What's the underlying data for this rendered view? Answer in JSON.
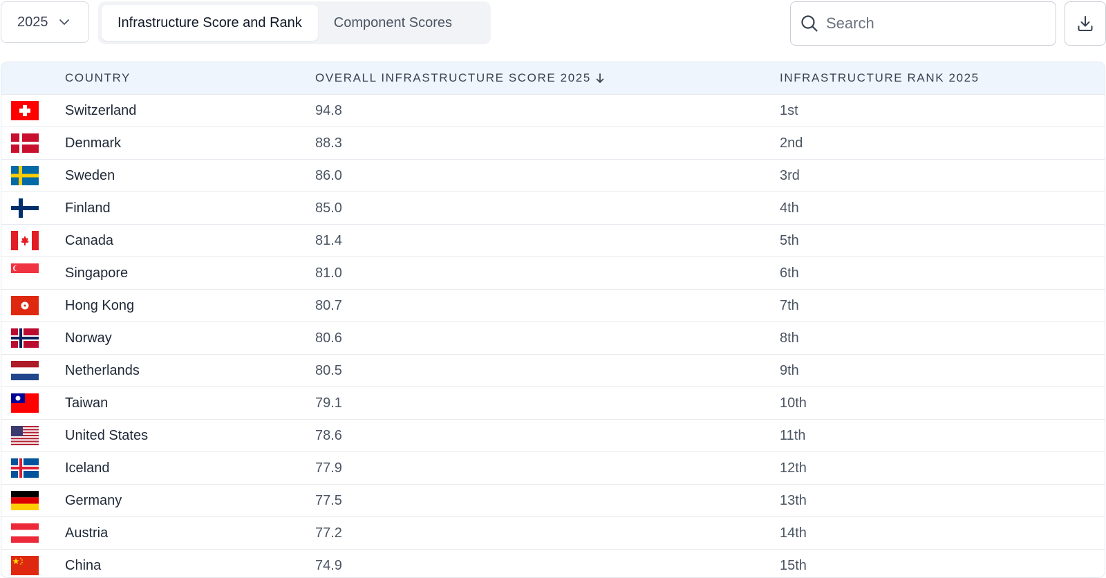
{
  "toolbar": {
    "year": "2025",
    "tabs": [
      {
        "label": "Infrastructure Score and Rank",
        "active": true
      },
      {
        "label": "Component Scores",
        "active": false
      }
    ],
    "search_placeholder": "Search",
    "icons": [
      "chevron-down-icon",
      "search-icon",
      "download-icon"
    ]
  },
  "table": {
    "headers": {
      "country": "COUNTRY",
      "score": "OVERALL INFRASTRUCTURE SCORE 2025",
      "rank": "INFRASTRUCTURE RANK 2025"
    },
    "sort": {
      "column": "score",
      "direction": "descending"
    },
    "rows": [
      {
        "flag": "switzerland",
        "country": "Switzerland",
        "score": "94.8",
        "rank": "1st"
      },
      {
        "flag": "denmark",
        "country": "Denmark",
        "score": "88.3",
        "rank": "2nd"
      },
      {
        "flag": "sweden",
        "country": "Sweden",
        "score": "86.0",
        "rank": "3rd"
      },
      {
        "flag": "finland",
        "country": "Finland",
        "score": "85.0",
        "rank": "4th"
      },
      {
        "flag": "canada",
        "country": "Canada",
        "score": "81.4",
        "rank": "5th"
      },
      {
        "flag": "singapore",
        "country": "Singapore",
        "score": "81.0",
        "rank": "6th"
      },
      {
        "flag": "hong-kong",
        "country": "Hong Kong",
        "score": "80.7",
        "rank": "7th"
      },
      {
        "flag": "norway",
        "country": "Norway",
        "score": "80.6",
        "rank": "8th"
      },
      {
        "flag": "netherlands",
        "country": "Netherlands",
        "score": "80.5",
        "rank": "9th"
      },
      {
        "flag": "taiwan",
        "country": "Taiwan",
        "score": "79.1",
        "rank": "10th"
      },
      {
        "flag": "united-states",
        "country": "United States",
        "score": "78.6",
        "rank": "11th"
      },
      {
        "flag": "iceland",
        "country": "Iceland",
        "score": "77.9",
        "rank": "12th"
      },
      {
        "flag": "germany",
        "country": "Germany",
        "score": "77.5",
        "rank": "13th"
      },
      {
        "flag": "austria",
        "country": "Austria",
        "score": "77.2",
        "rank": "14th"
      },
      {
        "flag": "china",
        "country": "China",
        "score": "74.9",
        "rank": "15th"
      }
    ]
  }
}
